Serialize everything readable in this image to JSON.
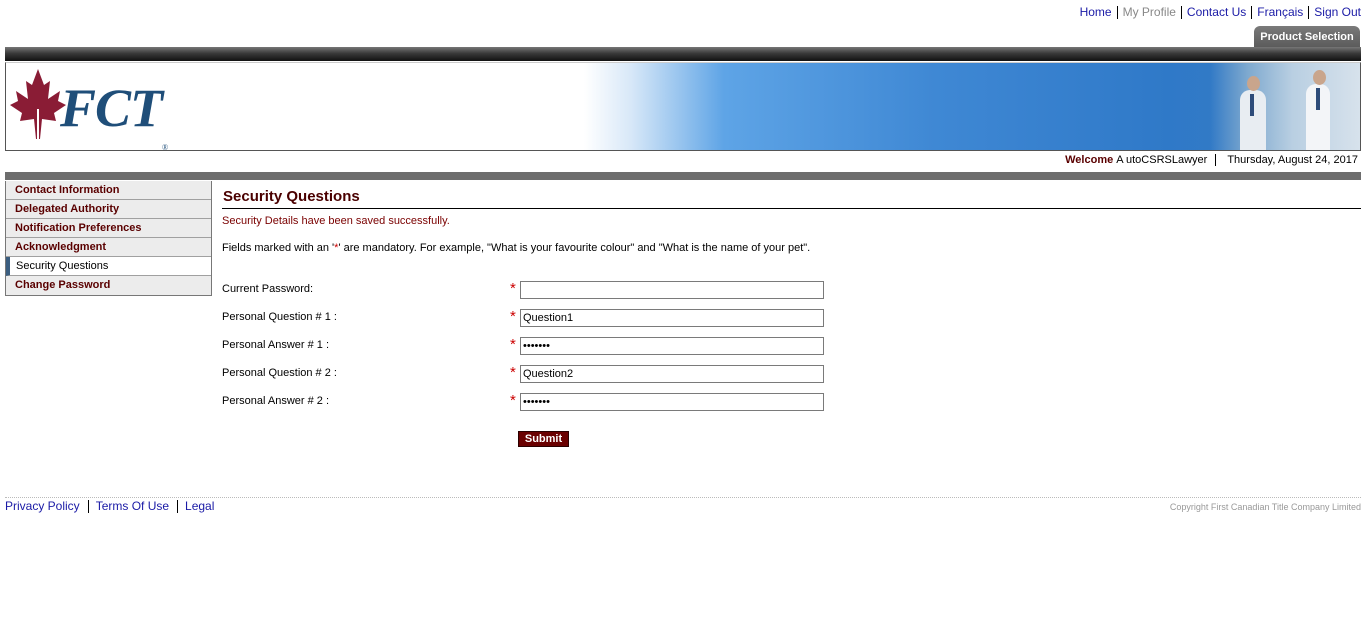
{
  "top_nav": {
    "home": "Home",
    "my_profile": "My Profile",
    "contact_us": "Contact Us",
    "francais": "Français",
    "sign_out": "Sign Out"
  },
  "product_tab": "Product Selection",
  "brand": {
    "logo_text": "FCT",
    "registered": "®"
  },
  "welcome": {
    "label": "Welcome",
    "username": "A utoCSRSLawyer",
    "date": "Thursday, August 24, 2017"
  },
  "sidebar": {
    "items": [
      {
        "label": "Contact Information",
        "active": false
      },
      {
        "label": "Delegated Authority",
        "active": false
      },
      {
        "label": "Notification Preferences",
        "active": false
      },
      {
        "label": "Acknowledgment",
        "active": false
      },
      {
        "label": "Security Questions",
        "active": true
      },
      {
        "label": "Change Password",
        "active": false
      }
    ]
  },
  "main": {
    "title": "Security Questions",
    "success_message": "Security Details have been saved successfully.",
    "instructions_pre": "Fields marked with an '",
    "instructions_ast": "*",
    "instructions_post": "' are mandatory. For example, \"What is your favourite colour\" and \"What is the name of your pet\"."
  },
  "form": {
    "required_mark": "*",
    "fields": [
      {
        "label": "Current Password:",
        "value": "",
        "type": "password"
      },
      {
        "label": "Personal Question # 1 :",
        "value": "Question1",
        "type": "text"
      },
      {
        "label": "Personal Answer # 1 :",
        "value": "1234567",
        "type": "password"
      },
      {
        "label": "Personal Question # 2 :",
        "value": "Question2",
        "type": "text"
      },
      {
        "label": "Personal Answer # 2 :",
        "value": "1234567",
        "type": "password"
      }
    ],
    "submit_label": "Submit"
  },
  "footer": {
    "privacy": "Privacy Policy",
    "terms": "Terms Of Use",
    "legal": "Legal",
    "copyright": "Copyright First Canadian Title Company Limited"
  },
  "colors": {
    "brand_maroon": "#6a0000",
    "link_blue": "#1a1aa6",
    "logo_blue": "#1f4e79",
    "banner_blue": "#2f79c8"
  }
}
